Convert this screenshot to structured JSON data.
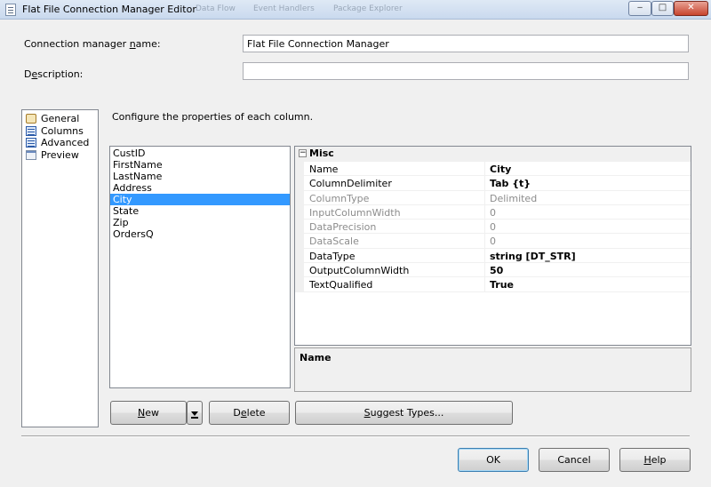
{
  "window": {
    "title": "Flat File Connection Manager Editor",
    "background_tabs": [
      "Data Flow",
      "Event Handlers",
      "Package Explorer"
    ],
    "controls": {
      "minimize": "‒",
      "maximize": "□",
      "close": "✕"
    }
  },
  "connection": {
    "name_label_pre": "Connection manager ",
    "name_label_u": "n",
    "name_label_post": "ame:",
    "name_value": "Flat File Connection Manager",
    "desc_label_pre": "D",
    "desc_label_u": "e",
    "desc_label_post": "scription:",
    "desc_value": ""
  },
  "nav": {
    "items": [
      {
        "label": "General",
        "icon": "general-icon"
      },
      {
        "label": "Columns",
        "icon": "columns-icon"
      },
      {
        "label": "Advanced",
        "icon": "advanced-icon"
      },
      {
        "label": "Preview",
        "icon": "preview-icon"
      }
    ]
  },
  "instructions": "Configure the properties of each column.",
  "columns": {
    "items": [
      "CustID",
      "FirstName",
      "LastName",
      "Address",
      "City",
      "State",
      "Zip",
      "OrdersQ"
    ],
    "selected": "City"
  },
  "properties": {
    "category": "Misc",
    "collapse_symbol": "−",
    "rows": [
      {
        "name": "Name",
        "value": "City"
      },
      {
        "name": "ColumnDelimiter",
        "value": "Tab {t}"
      },
      {
        "name": "ColumnType",
        "value": "Delimited"
      },
      {
        "name": "InputColumnWidth",
        "value": "0"
      },
      {
        "name": "DataPrecision",
        "value": "0"
      },
      {
        "name": "DataScale",
        "value": "0"
      },
      {
        "name": "DataType",
        "value": "string [DT_STR]"
      },
      {
        "name": "OutputColumnWidth",
        "value": "50"
      },
      {
        "name": "TextQualified",
        "value": "True"
      }
    ],
    "description_title": "Name"
  },
  "buttons": {
    "new_u": "N",
    "new_post": "ew",
    "delete_pre": "D",
    "delete_u": "e",
    "delete_post": "lete",
    "suggest_u": "S",
    "suggest_post": "uggest Types...",
    "ok": "OK",
    "cancel": "Cancel",
    "help_u": "H",
    "help_post": "elp"
  }
}
